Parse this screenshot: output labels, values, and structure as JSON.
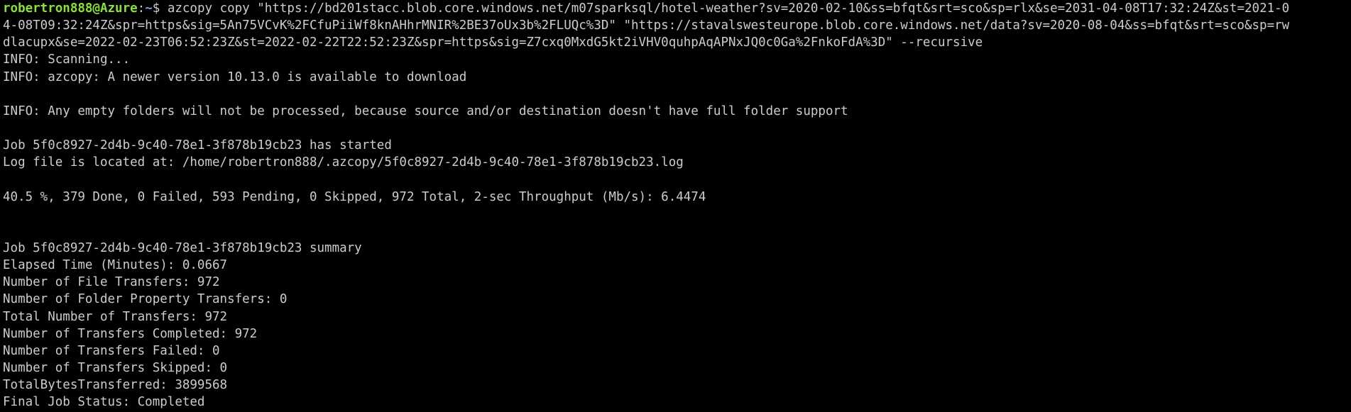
{
  "terminal": {
    "prompt": {
      "user_host": "robertron888@Azure",
      "separator": ":",
      "path": "~",
      "symbol": "$ "
    },
    "command_line_1": "azcopy copy \"https://bd201stacc.blob.core.windows.net/m07sparksql/hotel-weather?sv=2020-02-10&ss=bfqt&srt=sco&sp=rlx&se=2031-04-08T17:32:24Z&st=2021-0",
    "command_line_2": "4-08T09:32:24Z&spr=https&sig=5An75VCvK%2FCfuPiiWf8knAHhrMNIR%2BE37oUx3b%2FLUQc%3D\" \"https://stavalswesteurope.blob.core.windows.net/data?sv=2020-08-04&ss=bfqt&srt=sco&sp=rw",
    "command_line_3": "dlacupx&se=2022-02-23T06:52:23Z&st=2022-02-22T22:52:23Z&spr=https&sig=Z7cxq0MxdG5kt2iVHV0quhpAqAPNxJQ0c0Ga%2FnkoFdA%3D\" --recursive",
    "output": {
      "scanning": "INFO: Scanning...",
      "newer_version": "INFO: azcopy: A newer version 10.13.0 is available to download",
      "empty_folders": "INFO: Any empty folders will not be processed, because source and/or destination doesn't have full folder support",
      "job_started": "Job 5f0c8927-2d4b-9c40-78e1-3f878b19cb23 has started",
      "log_file": "Log file is located at: /home/robertron888/.azcopy/5f0c8927-2d4b-9c40-78e1-3f878b19cb23.log",
      "progress": "40.5 %, 379 Done, 0 Failed, 593 Pending, 0 Skipped, 972 Total, 2-sec Throughput (Mb/s): 6.4474",
      "summary_header": "Job 5f0c8927-2d4b-9c40-78e1-3f878b19cb23 summary",
      "elapsed_time": "Elapsed Time (Minutes): 0.0667",
      "file_transfers": "Number of File Transfers: 972",
      "folder_property_transfers": "Number of Folder Property Transfers: 0",
      "total_transfers": "Total Number of Transfers: 972",
      "transfers_completed": "Number of Transfers Completed: 972",
      "transfers_failed": "Number of Transfers Failed: 0",
      "transfers_skipped": "Number of Transfers Skipped: 0",
      "total_bytes": "TotalBytesTransferred: 3899568",
      "final_status": "Final Job Status: Completed"
    }
  }
}
